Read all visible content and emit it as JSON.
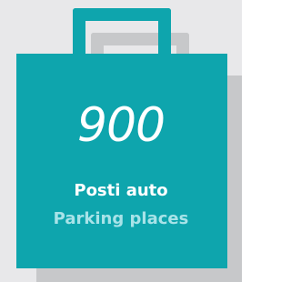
{
  "infographic": {
    "value": "900",
    "label_primary": "Posti auto",
    "label_secondary": "Parking places",
    "icon": "shopping-bag-icon"
  },
  "colors": {
    "background": "#e8e8ea",
    "bag": "#0ea5ad",
    "shadow": "#c7c8ca",
    "text_primary": "#ffffff",
    "text_secondary": "#a8e3e8"
  }
}
